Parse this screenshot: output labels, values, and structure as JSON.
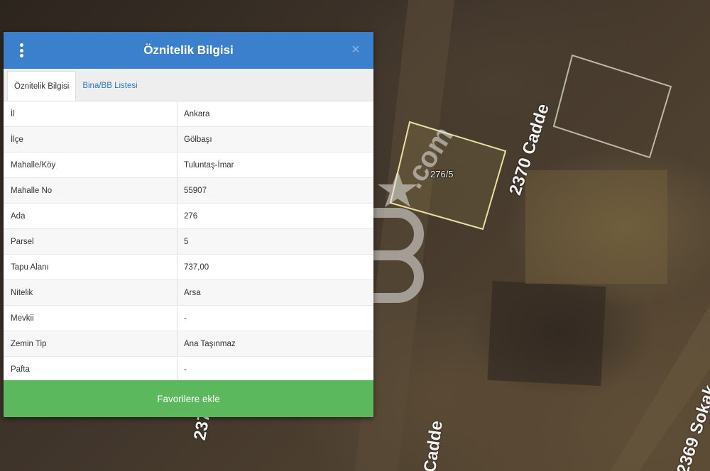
{
  "panel": {
    "title": "Öznitelik Bilgisi",
    "tabs": [
      {
        "label": "Öznitelik Bilgisi",
        "active": true
      },
      {
        "label": "Bina/BB Listesi",
        "active": false
      }
    ],
    "rows": [
      {
        "key": "İl",
        "value": "Ankara"
      },
      {
        "key": "İlçe",
        "value": "Gölbaşı"
      },
      {
        "key": "Mahalle/Köy",
        "value": "Tuluntaş-İmar"
      },
      {
        "key": "Mahalle No",
        "value": "55907"
      },
      {
        "key": "Ada",
        "value": "276"
      },
      {
        "key": "Parsel",
        "value": "5"
      },
      {
        "key": "Tapu Alanı",
        "value": "737,00"
      },
      {
        "key": "Nitelik",
        "value": "Arsa"
      },
      {
        "key": "Mevkii",
        "value": "-"
      },
      {
        "key": "Zemin Tip",
        "value": "Ana Taşınmaz"
      },
      {
        "key": "Pafta",
        "value": "-"
      }
    ],
    "favorite_label": "Favorilere ekle"
  },
  "map": {
    "parcel_label": "276/5",
    "roads": {
      "cadde_right": "2370 Cadde",
      "cadde_bottom_left": "237",
      "cadde_bottom_mid": "Cadde",
      "sokak": "2369 Sokak"
    },
    "watermark": ".com"
  },
  "colors": {
    "header": "#3a80cc",
    "button": "#5cb85c",
    "parcel_outline": "#e8e0a0"
  },
  "icons": {
    "menu": "vertical-dots-icon",
    "close": "close-icon",
    "watermark_logo": "cb-logo"
  }
}
